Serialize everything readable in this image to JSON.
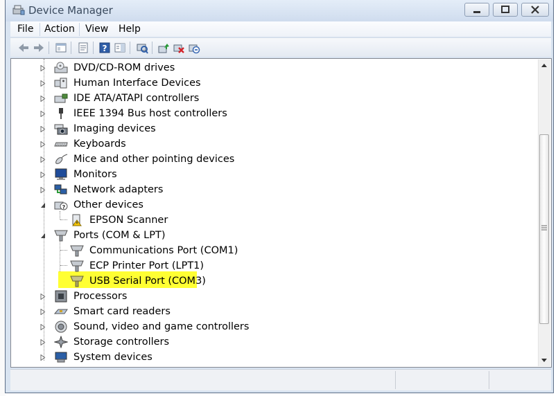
{
  "window": {
    "title": "Device Manager"
  },
  "menu": [
    {
      "label": "File"
    },
    {
      "label": "Action"
    },
    {
      "label": "View"
    },
    {
      "label": "Help"
    }
  ],
  "toolbar_icons": [
    "back-icon",
    "forward-icon",
    "console-tree-icon",
    "properties-icon",
    "help-icon",
    "action-pane-icon",
    "scan-hardware-icon",
    "update-driver-icon",
    "uninstall-icon",
    "disable-icon"
  ],
  "tree": [
    {
      "label": "DVD/CD-ROM drives",
      "icon": "dvd-drive-icon",
      "level": 0,
      "expanded": false
    },
    {
      "label": "Human Interface Devices",
      "icon": "hid-icon",
      "level": 0,
      "expanded": false
    },
    {
      "label": "IDE ATA/ATAPI controllers",
      "icon": "ide-controller-icon",
      "level": 0,
      "expanded": false
    },
    {
      "label": "IEEE 1394 Bus host controllers",
      "icon": "ieee1394-icon",
      "level": 0,
      "expanded": false
    },
    {
      "label": "Imaging devices",
      "icon": "camera-icon",
      "level": 0,
      "expanded": false
    },
    {
      "label": "Keyboards",
      "icon": "keyboard-icon",
      "level": 0,
      "expanded": false
    },
    {
      "label": "Mice and other pointing devices",
      "icon": "mouse-icon",
      "level": 0,
      "expanded": false
    },
    {
      "label": "Monitors",
      "icon": "monitor-icon",
      "level": 0,
      "expanded": false
    },
    {
      "label": "Network adapters",
      "icon": "network-adapter-icon",
      "level": 0,
      "expanded": false
    },
    {
      "label": "Other devices",
      "icon": "unknown-device-icon",
      "level": 0,
      "expanded": true
    },
    {
      "label": "EPSON Scanner",
      "icon": "warning-device-icon",
      "level": 1
    },
    {
      "label": "Ports (COM & LPT)",
      "icon": "port-icon",
      "level": 0,
      "expanded": true
    },
    {
      "label": "Communications Port (COM1)",
      "icon": "port-icon",
      "level": 1
    },
    {
      "label": "ECP Printer Port (LPT1)",
      "icon": "port-icon",
      "level": 1
    },
    {
      "label": "USB Serial Port (COM3)",
      "icon": "port-icon",
      "level": 1,
      "highlighted": true
    },
    {
      "label": "Processors",
      "icon": "processor-icon",
      "level": 0,
      "expanded": false
    },
    {
      "label": "Smart card readers",
      "icon": "smartcard-icon",
      "level": 0,
      "expanded": false
    },
    {
      "label": "Sound, video and game controllers",
      "icon": "sound-icon",
      "level": 0,
      "expanded": false
    },
    {
      "label": "Storage controllers",
      "icon": "storage-icon",
      "level": 0,
      "expanded": false
    },
    {
      "label": "System devices",
      "icon": "system-icon",
      "level": 0,
      "expanded": false
    }
  ],
  "colors": {
    "highlight": "#ffff33",
    "chrome": "#d9e4f1"
  }
}
